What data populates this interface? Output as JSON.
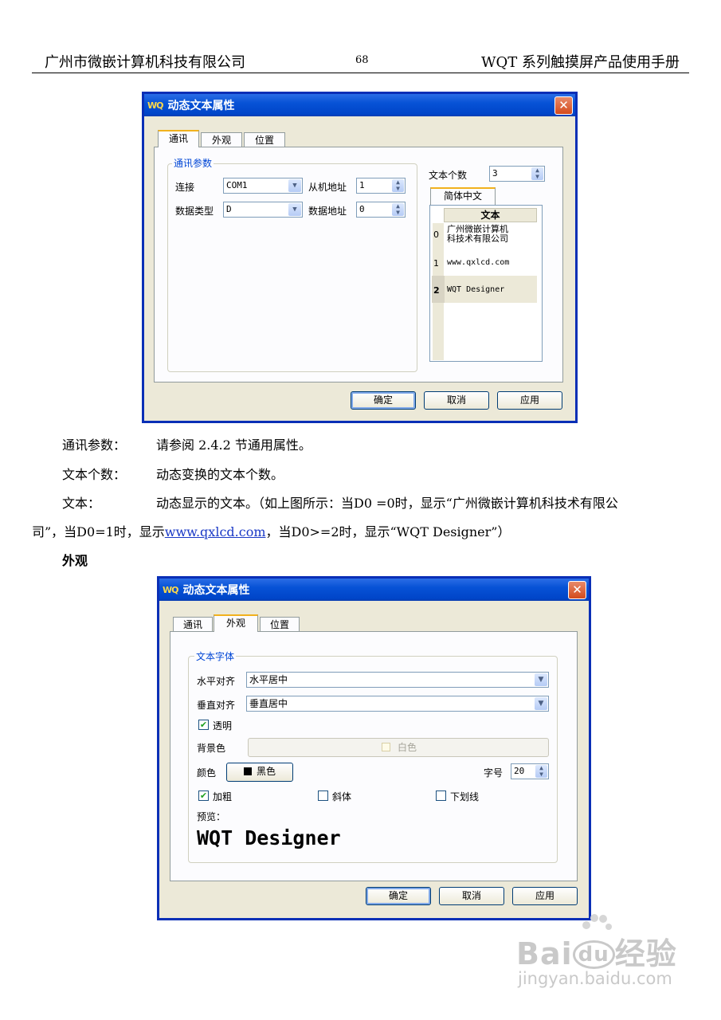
{
  "header": {
    "left": "广州市微嵌计算机科技有限公司",
    "page_number": "68",
    "right": "WQT 系列触摸屏产品使用手册"
  },
  "dialog1": {
    "title": "动态文本属性",
    "app_icon": "WQ",
    "close_glyph": "✕",
    "tabs": [
      "通讯",
      "外观",
      "位置"
    ],
    "group_title": "通讯参数",
    "connect_label": "连接",
    "connect_value": "COM1",
    "slave_label": "从机地址",
    "slave_value": "1",
    "datatype_label": "数据类型",
    "datatype_value": "D",
    "dataaddr_label": "数据地址",
    "dataaddr_value": "0",
    "text_count_label": "文本个数",
    "text_count_value": "3",
    "lang_tab": "简体中文",
    "grid_header": "文本",
    "rows": [
      {
        "index": "0",
        "text1": "广州微嵌计算机",
        "text2": "科技术有限公司"
      },
      {
        "index": "1",
        "text1": "www.qxlcd.com",
        "text2": ""
      },
      {
        "index": "2",
        "text1": "WQT Designer",
        "text2": ""
      }
    ],
    "buttons": {
      "ok": "确定",
      "cancel": "取消",
      "apply": "应用"
    }
  },
  "body_text": {
    "p1_label": "通讯参数：",
    "p1_text": "请参阅 2.4.2 节通用属性。",
    "p2_label": "文本个数：",
    "p2_text": "动态变换的文本个数。",
    "p3_label": "文本：",
    "p3_text": "动态显示的文本。（如上图所示：当D0 =0时，显示“广州微嵌计算机科技术有限公",
    "p3_cont_a": "司”，当D0=1时，显示",
    "p3_link": "www.qxlcd.com",
    "p3_cont_b": "，当D0>=2时，显示“WQT Designer”）",
    "section": "外观"
  },
  "dialog2": {
    "title": "动态文本属性",
    "app_icon": "WQ",
    "close_glyph": "✕",
    "tabs": [
      "通讯",
      "外观",
      "位置"
    ],
    "group_title": "文本字体",
    "halign_label": "水平对齐",
    "halign_value": "水平居中",
    "valign_label": "垂直对齐",
    "valign_value": "垂直居中",
    "transparent_label": "透明",
    "transparent_checked": true,
    "bg_label": "背景色",
    "bg_value": "白色",
    "color_label": "颜色",
    "color_value": "黑色",
    "fontsize_label": "字号",
    "fontsize_value": "20",
    "bold_label": "加粗",
    "bold_checked": true,
    "italic_label": "斜体",
    "italic_checked": false,
    "underline_label": "下划线",
    "underline_checked": false,
    "preview_label": "预览：",
    "preview_text": "WQT Designer",
    "buttons": {
      "ok": "确定",
      "cancel": "取消",
      "apply": "应用"
    }
  },
  "watermark": {
    "brand": "Bai",
    "brand2": "du",
    "brand3": "经验",
    "url": "jingyan.baidu.com"
  },
  "colors": {
    "title_bar": "#0752d6",
    "accent_tab": "#f1b11d",
    "group_title": "#0046d5",
    "link": "#1a39c6"
  }
}
